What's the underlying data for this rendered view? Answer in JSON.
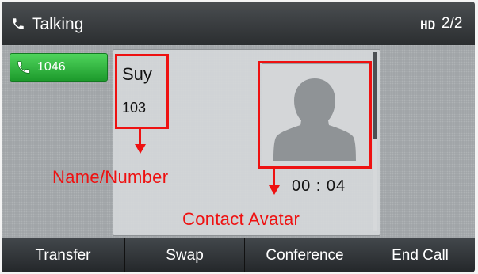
{
  "status_bar": {
    "title": "Talking",
    "hd_label": "HD",
    "line_counter": "2/2"
  },
  "line_key": {
    "label": "1046",
    "icon": "phone-handset-icon",
    "color": "#2fb33d"
  },
  "call": {
    "name": "Suy",
    "number": "103",
    "duration": "00 : 04",
    "avatar": "contact-silhouette-icon"
  },
  "annotations": {
    "name_number": "Name/Number",
    "contact_avatar": "Contact Avatar",
    "color": "#ee1111"
  },
  "softkeys": [
    "Transfer",
    "Swap",
    "Conference",
    "End Call"
  ]
}
